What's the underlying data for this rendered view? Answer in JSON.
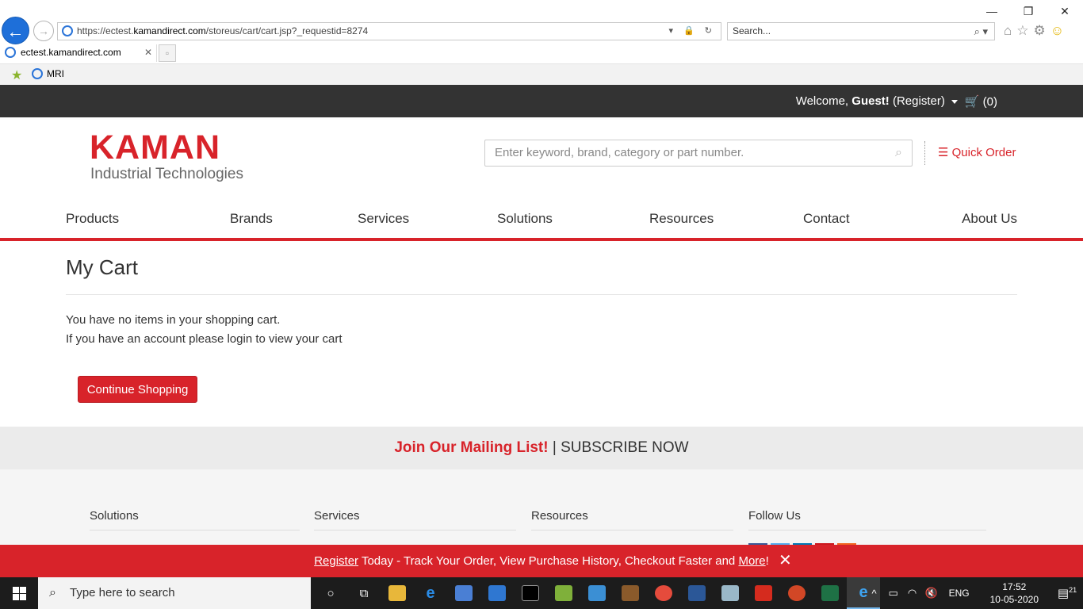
{
  "browser": {
    "url_prefix": "https://ectest.",
    "url_host": "kamandirect.com",
    "url_path": "/storeus/cart/cart.jsp?_requestid=8274",
    "search_placeholder": "Search...",
    "tab_title": "ectest.kamandirect.com",
    "favorites": [
      {
        "label": "MRI"
      }
    ]
  },
  "topbar": {
    "welcome_prefix": "Welcome,",
    "welcome_name": "Guest!",
    "register": "(Register)",
    "cart_count": "(0)"
  },
  "header": {
    "logo_main": "KAMAN",
    "logo_sub": "Industrial Technologies",
    "search_placeholder": "Enter keyword, brand, category or part number.",
    "quick_order": "Quick Order"
  },
  "nav": {
    "items": [
      {
        "label": "Products"
      },
      {
        "label": "Brands"
      },
      {
        "label": "Services"
      },
      {
        "label": "Solutions"
      },
      {
        "label": "Resources"
      },
      {
        "label": "Contact"
      },
      {
        "label": "About Us"
      }
    ]
  },
  "main": {
    "title": "My Cart",
    "message1": "You have no items in your shopping cart.",
    "message2": "If you have an account please login to view your cart",
    "continue_button": "Continue Shopping"
  },
  "mailing": {
    "join": "Join Our Mailing List!",
    "separator": "|",
    "subscribe": "SUBSCRIBE NOW"
  },
  "footer": {
    "columns": [
      {
        "title": "Solutions"
      },
      {
        "title": "Services"
      },
      {
        "title": "Resources"
      },
      {
        "title": "Follow Us"
      }
    ]
  },
  "banner": {
    "register": "Register",
    "middle": " Today - Track Your Order, View Purchase History, Checkout Faster and ",
    "more": "More",
    "end": "!",
    "close": "✕"
  },
  "taskbar": {
    "search_placeholder": "Type here to search",
    "language": "ENG",
    "time": "17:52",
    "date": "10-05-2020",
    "notification_count": "21"
  },
  "colors": {
    "brand_red": "#d8232a",
    "topbar": "#333333",
    "taskbar": "#1c1c1c"
  }
}
